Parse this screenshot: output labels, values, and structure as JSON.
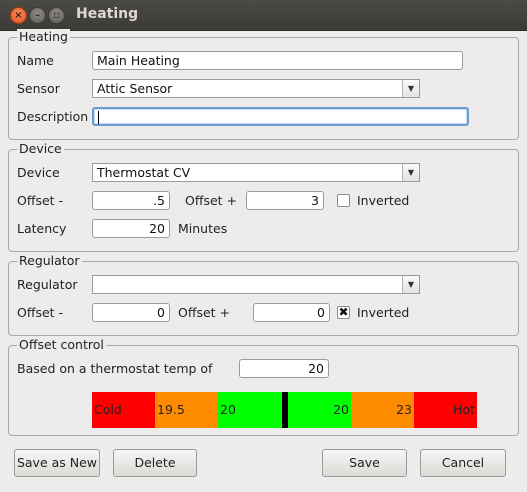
{
  "window": {
    "title": "Heating"
  },
  "heating": {
    "legend": "Heating",
    "name_label": "Name",
    "name_value": "Main Heating",
    "sensor_label": "Sensor",
    "sensor_value": "Attic Sensor",
    "description_label": "Description",
    "description_value": ""
  },
  "device": {
    "legend": "Device",
    "device_label": "Device",
    "device_value": "Thermostat CV",
    "offset_minus_label": "Offset -",
    "offset_minus_value": ".5",
    "offset_plus_label": "Offset +",
    "offset_plus_value": "3",
    "inverted_label": "Inverted",
    "inverted_checked": false,
    "latency_label": "Latency",
    "latency_value": "20",
    "latency_unit": "Minutes"
  },
  "regulator": {
    "legend": "Regulator",
    "regulator_label": "Regulator",
    "regulator_value": "",
    "offset_minus_label": "Offset -",
    "offset_minus_value": "0",
    "offset_plus_label": "Offset +",
    "offset_plus_value": "0",
    "inverted_label": "Inverted",
    "inverted_checked": true,
    "inverted_mark": "✖"
  },
  "offset_control": {
    "legend": "Offset control",
    "based_label": "Based on a thermostat temp of",
    "based_value": "20",
    "bar": {
      "cold_label": "Cold",
      "low_value": "19.5",
      "mid_left_value": "20",
      "mid_right_value": "20",
      "high_value": "23",
      "hot_label": "Hot",
      "colors": {
        "cold": "#ff0000",
        "low": "#ff8c00",
        "ok": "#00ff00",
        "marker": "#000000"
      }
    }
  },
  "buttons": {
    "save_as_new": "Save as New",
    "delete": "Delete",
    "save": "Save",
    "cancel": "Cancel"
  }
}
